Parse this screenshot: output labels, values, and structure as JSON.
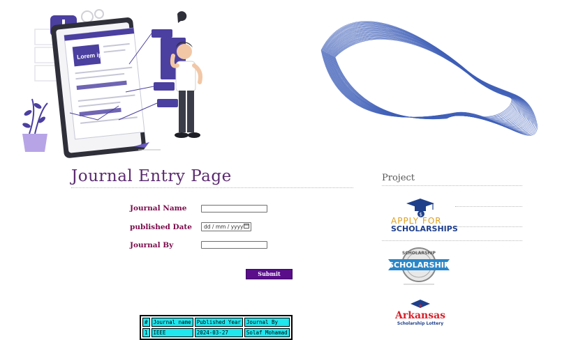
{
  "page": {
    "title": "Journal Entry Page",
    "sidebar_title": "Project"
  },
  "hero": {
    "illustration_label": "Lorem ipsum"
  },
  "form": {
    "fields": [
      {
        "label": "Journal Name",
        "value": ""
      },
      {
        "label": "published Date",
        "value": "dd / mm / yyyy"
      },
      {
        "label": "Journal By",
        "value": ""
      }
    ],
    "submit_label": "Submit"
  },
  "table": {
    "headers": [
      "#",
      "Journal name",
      "Published Year",
      "Journal By"
    ],
    "rows": [
      [
        "1",
        "IEEE",
        "2024-03-27",
        "Solaf Mohamad"
      ]
    ]
  },
  "sidebar": {
    "logos": [
      {
        "line1": "APPLY FOR",
        "line2": "SCHOLARSHIPS"
      },
      {
        "ribbon": "SCHOLARSHIP",
        "ring": "SCHOLARSHIP"
      },
      {
        "name": "Arkansas",
        "sub": "Scholarship Lottery"
      }
    ]
  },
  "colors": {
    "title": "#5b2a70",
    "label": "#7a0a4a",
    "submit_bg": "#5a0e8a",
    "table_cell": "#20e6ee",
    "accent_purple": "#4b3fa0",
    "wave": "#3f5fb8"
  }
}
